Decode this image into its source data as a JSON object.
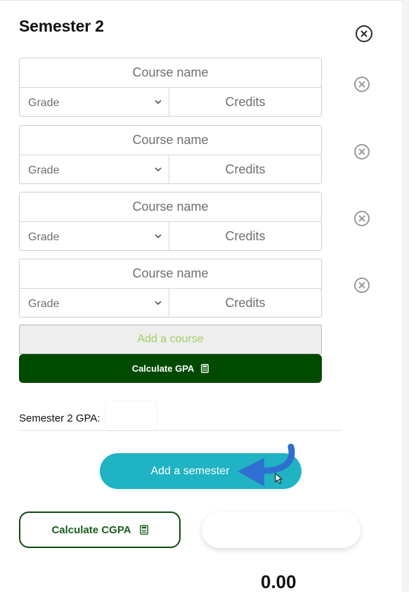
{
  "semester": {
    "title": "Semester 2",
    "courses": [
      {
        "name_placeholder": "Course name",
        "grade_label": "Grade",
        "credits_placeholder": "Credits"
      },
      {
        "name_placeholder": "Course name",
        "grade_label": "Grade",
        "credits_placeholder": "Credits"
      },
      {
        "name_placeholder": "Course name",
        "grade_label": "Grade",
        "credits_placeholder": "Credits"
      },
      {
        "name_placeholder": "Course name",
        "grade_label": "Grade",
        "credits_placeholder": "Credits"
      }
    ],
    "add_course_label": "Add a course",
    "calculate_gpa_label": "Calculate GPA",
    "gpa_label": "Semester 2 GPA:",
    "gpa_value": ""
  },
  "add_semester_label": "Add a semester",
  "calculate_cgpa_label": "Calculate CGPA",
  "cgpa_result": "",
  "cgpa_value": "0.00",
  "colors": {
    "dark_green": "#004a00",
    "teal": "#1fb3c4",
    "add_course_text": "#a6cf62",
    "arrow_blue": "#2f6fd1"
  },
  "icons": [
    "close-icon",
    "chevron-down-icon",
    "calculator-icon",
    "arrow-icon",
    "cursor-icon"
  ]
}
